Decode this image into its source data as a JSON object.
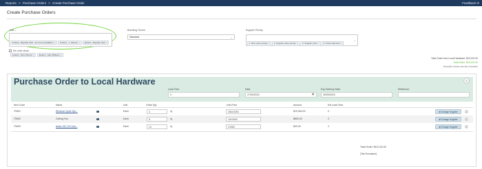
{
  "topbar": {
    "breadcrumb": [
      "Reports",
      ">",
      "Purchase Orders",
      ">",
      "Create Purchase Order"
    ],
    "feedback": "Feedback ✉"
  },
  "page": {
    "title": "Create Purchase Orders"
  },
  "filters": {
    "jobs_label": "Jobs ⌄",
    "jobs_tags": [
      "Jenkins - Bayside Club - En Cond Installation",
      "Jenkins - J. Hanson",
      "Jenkins - Bayside Club",
      "Jenkins - Berry Brown",
      "Jenkins - Alan Williams"
    ],
    "branding_label": "Branding Theme",
    "branding_value": "Standard",
    "supplier_label": "Supplier Priority",
    "supplier_tags": [
      "1. Next order priority",
      "2. Supplier order priority",
      "3. Supplier price",
      "4. Order lead time"
    ],
    "reorder_label": "Re-order stock"
  },
  "summary": {
    "total_order_line": "Total Order from Local Hardware: $15,132.00",
    "total_order_green": "Total Order: $15,132.00",
    "tax_note": "Amounts shown are tax exclusive"
  },
  "po": {
    "title": "Purchase Order to Local Hardware",
    "close": "×",
    "lead_time_label": "Lead Time",
    "lead_time_value": "0",
    "date_label": "Date",
    "date_value": "27/09/2023",
    "exp_label": "Exp Delivery Date",
    "exp_value": "30/09/2023",
    "ref_label": "Reference",
    "ref_value": "",
    "columns": [
      "Item Code",
      "Name",
      "Unit",
      "Order Qty",
      "Unit Price",
      "Amount",
      "Est Lead Time"
    ],
    "rows": [
      {
        "code": "ITM01",
        "name": "Reverse Cycle Spl...",
        "unit": "Each",
        "qty": "4",
        "price": "2516.0000",
        "amount": "$10,064.00",
        "lead": "0",
        "btn": "⇄ Change Supplier",
        "del": "×"
      },
      {
        "code": "ITM02",
        "name": "Ceiling Fan",
        "unit": "Each",
        "qty": "8",
        "price": "100.0000",
        "amount": "$800.00",
        "lead": "2",
        "btn": "⇄ Change Supplier",
        "del": "×"
      },
      {
        "code": "ITM03",
        "name": "Actec VIC 15 Colo...",
        "unit": "Each",
        "qty": "14",
        "price": "3.0000",
        "amount": "$42.00",
        "lead": "2",
        "btn": "⇄ Change Supplier",
        "del": "×"
      }
    ],
    "footer_total": "Total Order: $15,132.00",
    "footer_tax": "(Tax Exclusive)"
  }
}
